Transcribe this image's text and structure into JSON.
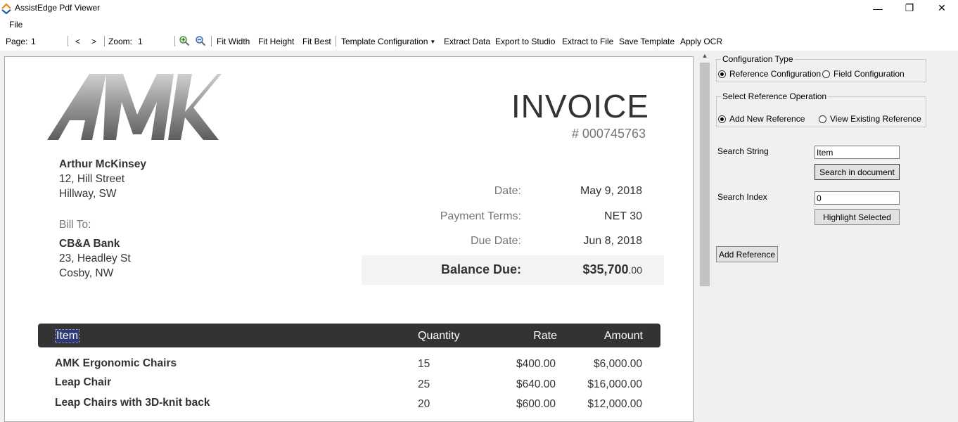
{
  "window": {
    "title": "AssistEdge Pdf Viewer",
    "minimize_glyph": "—",
    "restore_glyph": "❐",
    "close_glyph": "✕"
  },
  "menu": {
    "file": "File"
  },
  "toolbar": {
    "page_label": "Page:",
    "page_value": "1",
    "prev": "<",
    "next": ">",
    "zoom_label": "Zoom:",
    "zoom_value": "1",
    "fit_width": "Fit Width",
    "fit_height": "Fit Height",
    "fit_best": "Fit Best",
    "template_configuration": "Template Configuration",
    "extract_data": "Extract Data",
    "export_to_studio": "Export to Studio",
    "extract_to_file": "Extract to File",
    "save_template": "Save Template",
    "apply_ocr": "Apply OCR"
  },
  "invoice": {
    "title": "INVOICE",
    "number": "# 000745763",
    "sender": {
      "name": "Arthur McKinsey",
      "line1": "12, Hill Street",
      "line2": "Hillway, SW"
    },
    "bill_to_label": "Bill To:",
    "recipient": {
      "name": "CB&A Bank",
      "line1": "23, Headley St",
      "line2": "Cosby, NW"
    },
    "date_label": "Date:",
    "date_value": "May 9, 2018",
    "terms_label": "Payment Terms:",
    "terms_value": "NET 30",
    "due_label": "Due Date:",
    "due_value": "Jun 8, 2018",
    "balance_label": "Balance Due:",
    "balance_main": "$35,700",
    "balance_cents": ".00",
    "columns": {
      "item": "Item",
      "quantity": "Quantity",
      "rate": "Rate",
      "amount": "Amount"
    },
    "rows": [
      {
        "item": "AMK Ergonomic Chairs",
        "quantity": "15",
        "rate": "$400.00",
        "amount": "$6,000.00"
      },
      {
        "item": "Leap Chair",
        "quantity": "25",
        "rate": "$640.00",
        "amount": "$16,000.00"
      },
      {
        "item": "Leap Chairs with 3D-knit back",
        "quantity": "20",
        "rate": "$600.00",
        "amount": "$12,000.00"
      }
    ]
  },
  "panel": {
    "config_type_title": "Configuration Type",
    "reference_configuration": "Reference Configuration",
    "field_configuration": "Field Configuration",
    "ref_op_title": "Select Reference Operation",
    "add_new_reference": "Add New Reference",
    "view_existing_reference": "View Existing Reference",
    "search_string_label": "Search String",
    "search_string_value": "Item",
    "search_in_document": "Search in document",
    "search_index_label": "Search Index",
    "search_index_value": "0",
    "highlight_selected": "Highlight Selected",
    "add_reference": "Add Reference"
  }
}
